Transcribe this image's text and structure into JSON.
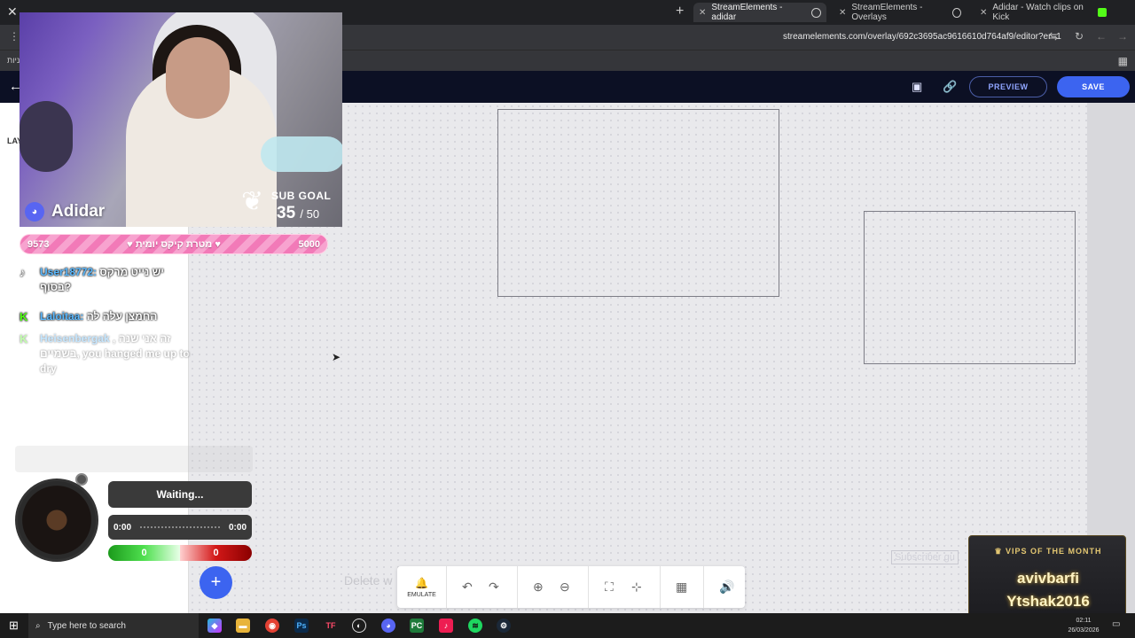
{
  "browser": {
    "tabs": [
      {
        "title": "StreamElements - adidar",
        "active": true
      },
      {
        "title": "StreamElements - Overlays",
        "active": false
      },
      {
        "title": "Adidar - Watch clips on Kick",
        "active": false
      }
    ],
    "url": "streamelements.com/overlay/692c3695ac9616610d764af9/editor?er=1",
    "bookmark": "ניות"
  },
  "editor": {
    "preview_label": "PREVIEW",
    "save_label": "SAVE",
    "layers_label": "LAY",
    "delete_hint": "Delete w",
    "toolbar": {
      "emulate_label": "EMULATE"
    },
    "subscriber_tag": "Subscriber gu"
  },
  "overlay": {
    "streamer_name": "Adidar",
    "sub_goal": {
      "label": "SUB GOAL",
      "current": "35",
      "target": "/ 50"
    },
    "goal_bar": {
      "left": "9573",
      "center": "♥ מטרת קיקס יומית ♥",
      "right": "5000"
    },
    "chat": [
      {
        "platform": "tiktok-icon",
        "user": "User18772:",
        "message": "יש נייט מרקס בסוף?"
      },
      {
        "platform": "kick-icon",
        "user": "Laloitaa:",
        "message": "החמצן עלה לה"
      },
      {
        "platform": "kick-icon",
        "user": "Heisenbergak",
        "message": ", זה אני שנה בשמיים, you hanged me up to dry"
      }
    ],
    "music": {
      "status": "Waiting...",
      "time_start": "0:00",
      "time_end": "0:00",
      "vote_left": "0",
      "vote_right": "0"
    },
    "vips": {
      "title": "VIPS OF THE MONTH",
      "names": [
        "avivbarfi",
        "Ytshak2016"
      ]
    }
  },
  "taskbar": {
    "search_placeholder": "Type here to search",
    "time": "02:11",
    "date": "26/03/2026"
  },
  "colors": {
    "accent": "#3c64f0",
    "editor_bar": "#0c1024",
    "pink_goal": "#f27ab8",
    "chat_user": "#58b8ff"
  }
}
